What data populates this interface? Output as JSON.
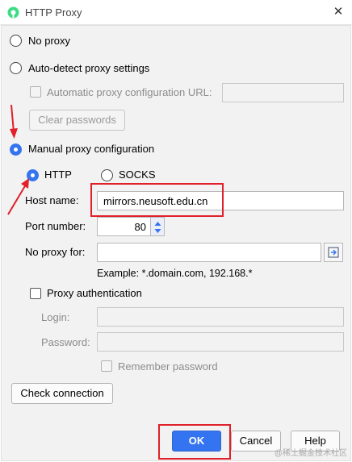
{
  "window": {
    "title": "HTTP Proxy",
    "close_glyph": "✕"
  },
  "options": {
    "no_proxy": "No proxy",
    "auto_detect": "Auto-detect proxy settings",
    "auto_config_url": "Automatic proxy configuration URL:",
    "clear_passwords": "Clear passwords",
    "manual": "Manual proxy configuration",
    "http": "HTTP",
    "socks": "SOCKS"
  },
  "fields": {
    "host_label": "Host name:",
    "host_value": "mirrors.neusoft.edu.cn",
    "port_label": "Port number:",
    "port_value": "80",
    "no_proxy_label": "No proxy for:",
    "no_proxy_value": "",
    "example": "Example: *.domain.com, 192.168.*"
  },
  "auth": {
    "label": "Proxy authentication",
    "login_label": "Login:",
    "password_label": "Password:",
    "remember": "Remember password"
  },
  "buttons": {
    "check_connection": "Check connection",
    "ok": "OK",
    "cancel": "Cancel",
    "help": "Help"
  },
  "state": {
    "selected_mode": "manual",
    "selected_protocol": "HTTP",
    "proxy_authentication": false
  },
  "watermark": "@稀土掘金技术社区",
  "colors": {
    "accent": "#3574f0",
    "annotation": "#e0202a"
  }
}
